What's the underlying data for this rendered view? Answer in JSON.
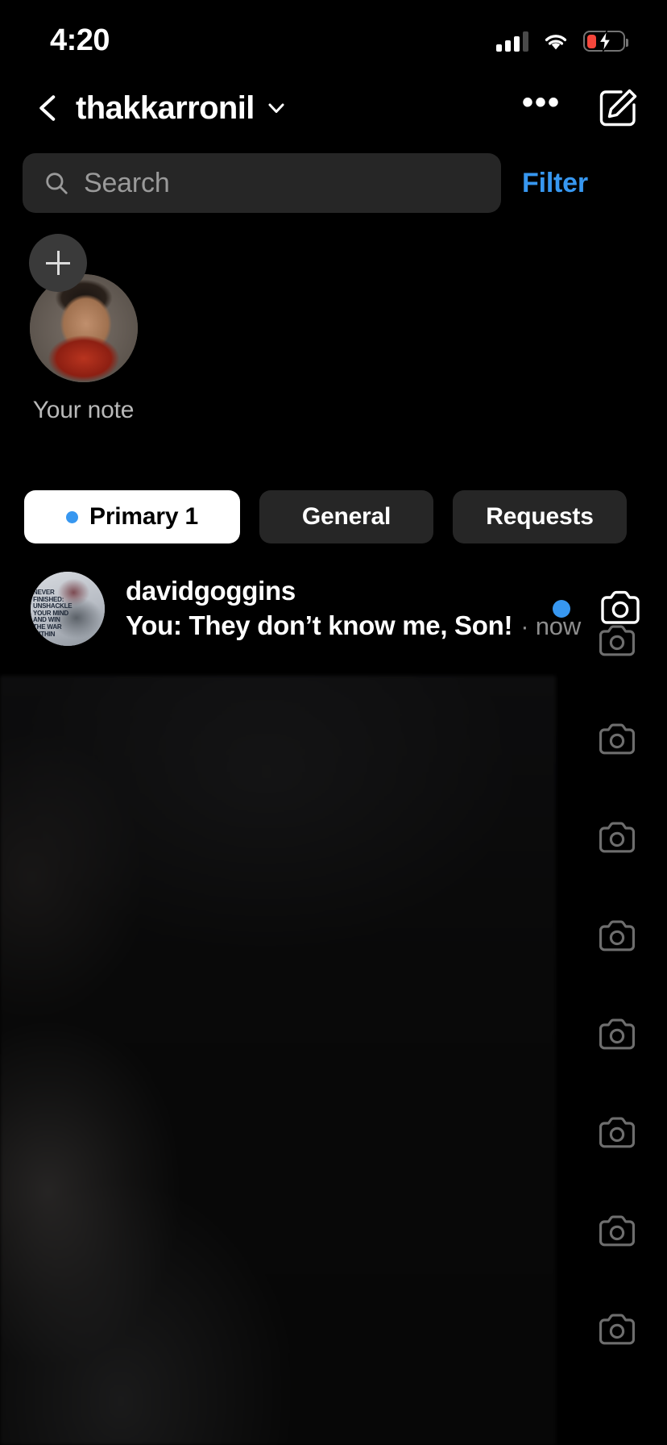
{
  "status_bar": {
    "time": "4:20",
    "signal_icon": "cellular-signal-icon",
    "wifi_icon": "wifi-icon",
    "battery_icon": "battery-charging-low-icon",
    "battery_level_pct": 26,
    "battery_color": "#f5463b",
    "charging": true
  },
  "header": {
    "back_icon": "chevron-left-icon",
    "title": "thakkarronil",
    "dropdown_icon": "chevron-down-icon",
    "more_label": "•••",
    "more_icon": "ellipsis-icon",
    "compose_icon": "compose-edit-icon"
  },
  "search": {
    "icon": "search-icon",
    "placeholder": "Search",
    "value": "",
    "filter_label": "Filter",
    "filter_color": "#3797f0"
  },
  "notes": {
    "add_icon": "plus-icon",
    "avatar_name": "your-avatar",
    "label": "Your note"
  },
  "tabs": [
    {
      "label": "Primary 1",
      "active": true,
      "has_dot": true,
      "dot_color": "#3797f0"
    },
    {
      "label": "General",
      "active": false,
      "has_dot": false
    },
    {
      "label": "Requests",
      "active": false,
      "has_dot": false
    }
  ],
  "chats": [
    {
      "username": "davidgoggins",
      "avatar_overlay_text": "Never finished: Unshackle your mind and win the war within",
      "snippet": "You: They don’t know me, Son!",
      "separator": " · ",
      "time": "now",
      "unread": true,
      "unread_dot_color": "#3797f0",
      "camera_icon": "camera-icon"
    }
  ],
  "ghost_cameras": {
    "icon": "camera-icon",
    "count": 8
  },
  "colors": {
    "background": "#000000",
    "surface": "#262626",
    "accent_blue": "#3797f0",
    "text_primary": "#ffffff",
    "text_secondary": "#8e8e8e"
  }
}
